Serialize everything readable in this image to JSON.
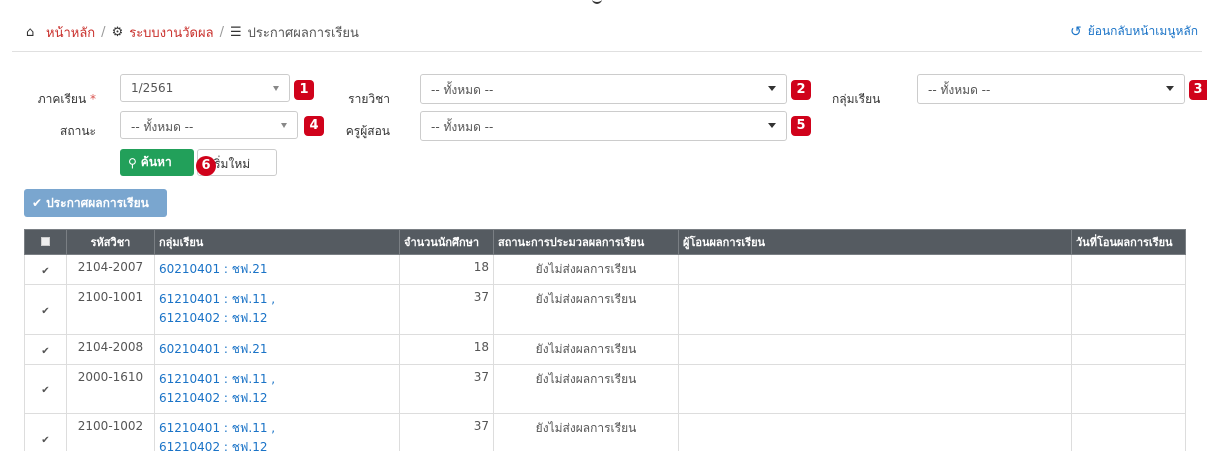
{
  "breadcrumb": {
    "home": "หน้าหลัก",
    "separator": "/",
    "section": "ระบบงานวัดผล",
    "current": "ประกาศผลการเรียน",
    "back_label": "ย้อนกลับหน้าเมนูหลัก",
    "home_icon": "home-icon",
    "gear_icon": "gear-icon",
    "list_icon": "list-icon",
    "back_icon": "back-arrow-icon"
  },
  "form": {
    "semester_label": "ภาคเรียน",
    "required_mark": "*",
    "semester_value": "1/2561",
    "subject_label": "รายวิชา",
    "subject_value": "-- ทั้งหมด --",
    "group_label": "กลุ่มเรียน",
    "group_value": "-- ทั้งหมด --",
    "status_label": "สถานะ",
    "status_value": "-- ทั้งหมด --",
    "teacher_label": "ครูผู้สอน",
    "teacher_value": "-- ทั้งหมด --",
    "search_button": "ค้นหา",
    "reset_button": "เริ่มใหม่",
    "badges": [
      "1",
      "2",
      "3",
      "4",
      "5",
      "6"
    ]
  },
  "announce_button": "ประกาศผลการเรียน",
  "table": {
    "columns": [
      "รหัสวิชา",
      "กลุ่มเรียน",
      "จำนวนนักศึกษา",
      "สถานะการประมวลผลการเรียน",
      "ผู้โอนผลการเรียน",
      "วันที่โอนผลการเรียน"
    ],
    "rows": [
      {
        "code": "2104-2007",
        "group1": "60210401 : ชฟ.21",
        "group2": "",
        "count": "18",
        "status": "ยังไม่ส่งผลการเรียน"
      },
      {
        "code": "2100-1001",
        "group1": "61210401 : ชฟ.11 ,",
        "group2": "61210402 : ชฟ.12",
        "count": "37",
        "status": "ยังไม่ส่งผลการเรียน"
      },
      {
        "code": "2104-2008",
        "group1": "60210401 : ชฟ.21",
        "group2": "",
        "count": "18",
        "status": "ยังไม่ส่งผลการเรียน"
      },
      {
        "code": "2000-1610",
        "group1": "61210401 : ชฟ.11 ,",
        "group2": "61210402 : ชฟ.12",
        "count": "37",
        "status": "ยังไม่ส่งผลการเรียน"
      },
      {
        "code": "2100-1002",
        "group1": "61210401 : ชฟ.11 ,",
        "group2": "61210402 : ชฟ.12",
        "count": "37",
        "status": "ยังไม่ส่งผลการเรียน"
      }
    ]
  },
  "colors": {
    "link": "#1a73c7",
    "breadcrumb_link": "#c9302c",
    "search_green": "#22a05a",
    "announce_blue": "#7aa6cf",
    "header_gray": "#555b61",
    "badge_red": "#d0021b"
  }
}
